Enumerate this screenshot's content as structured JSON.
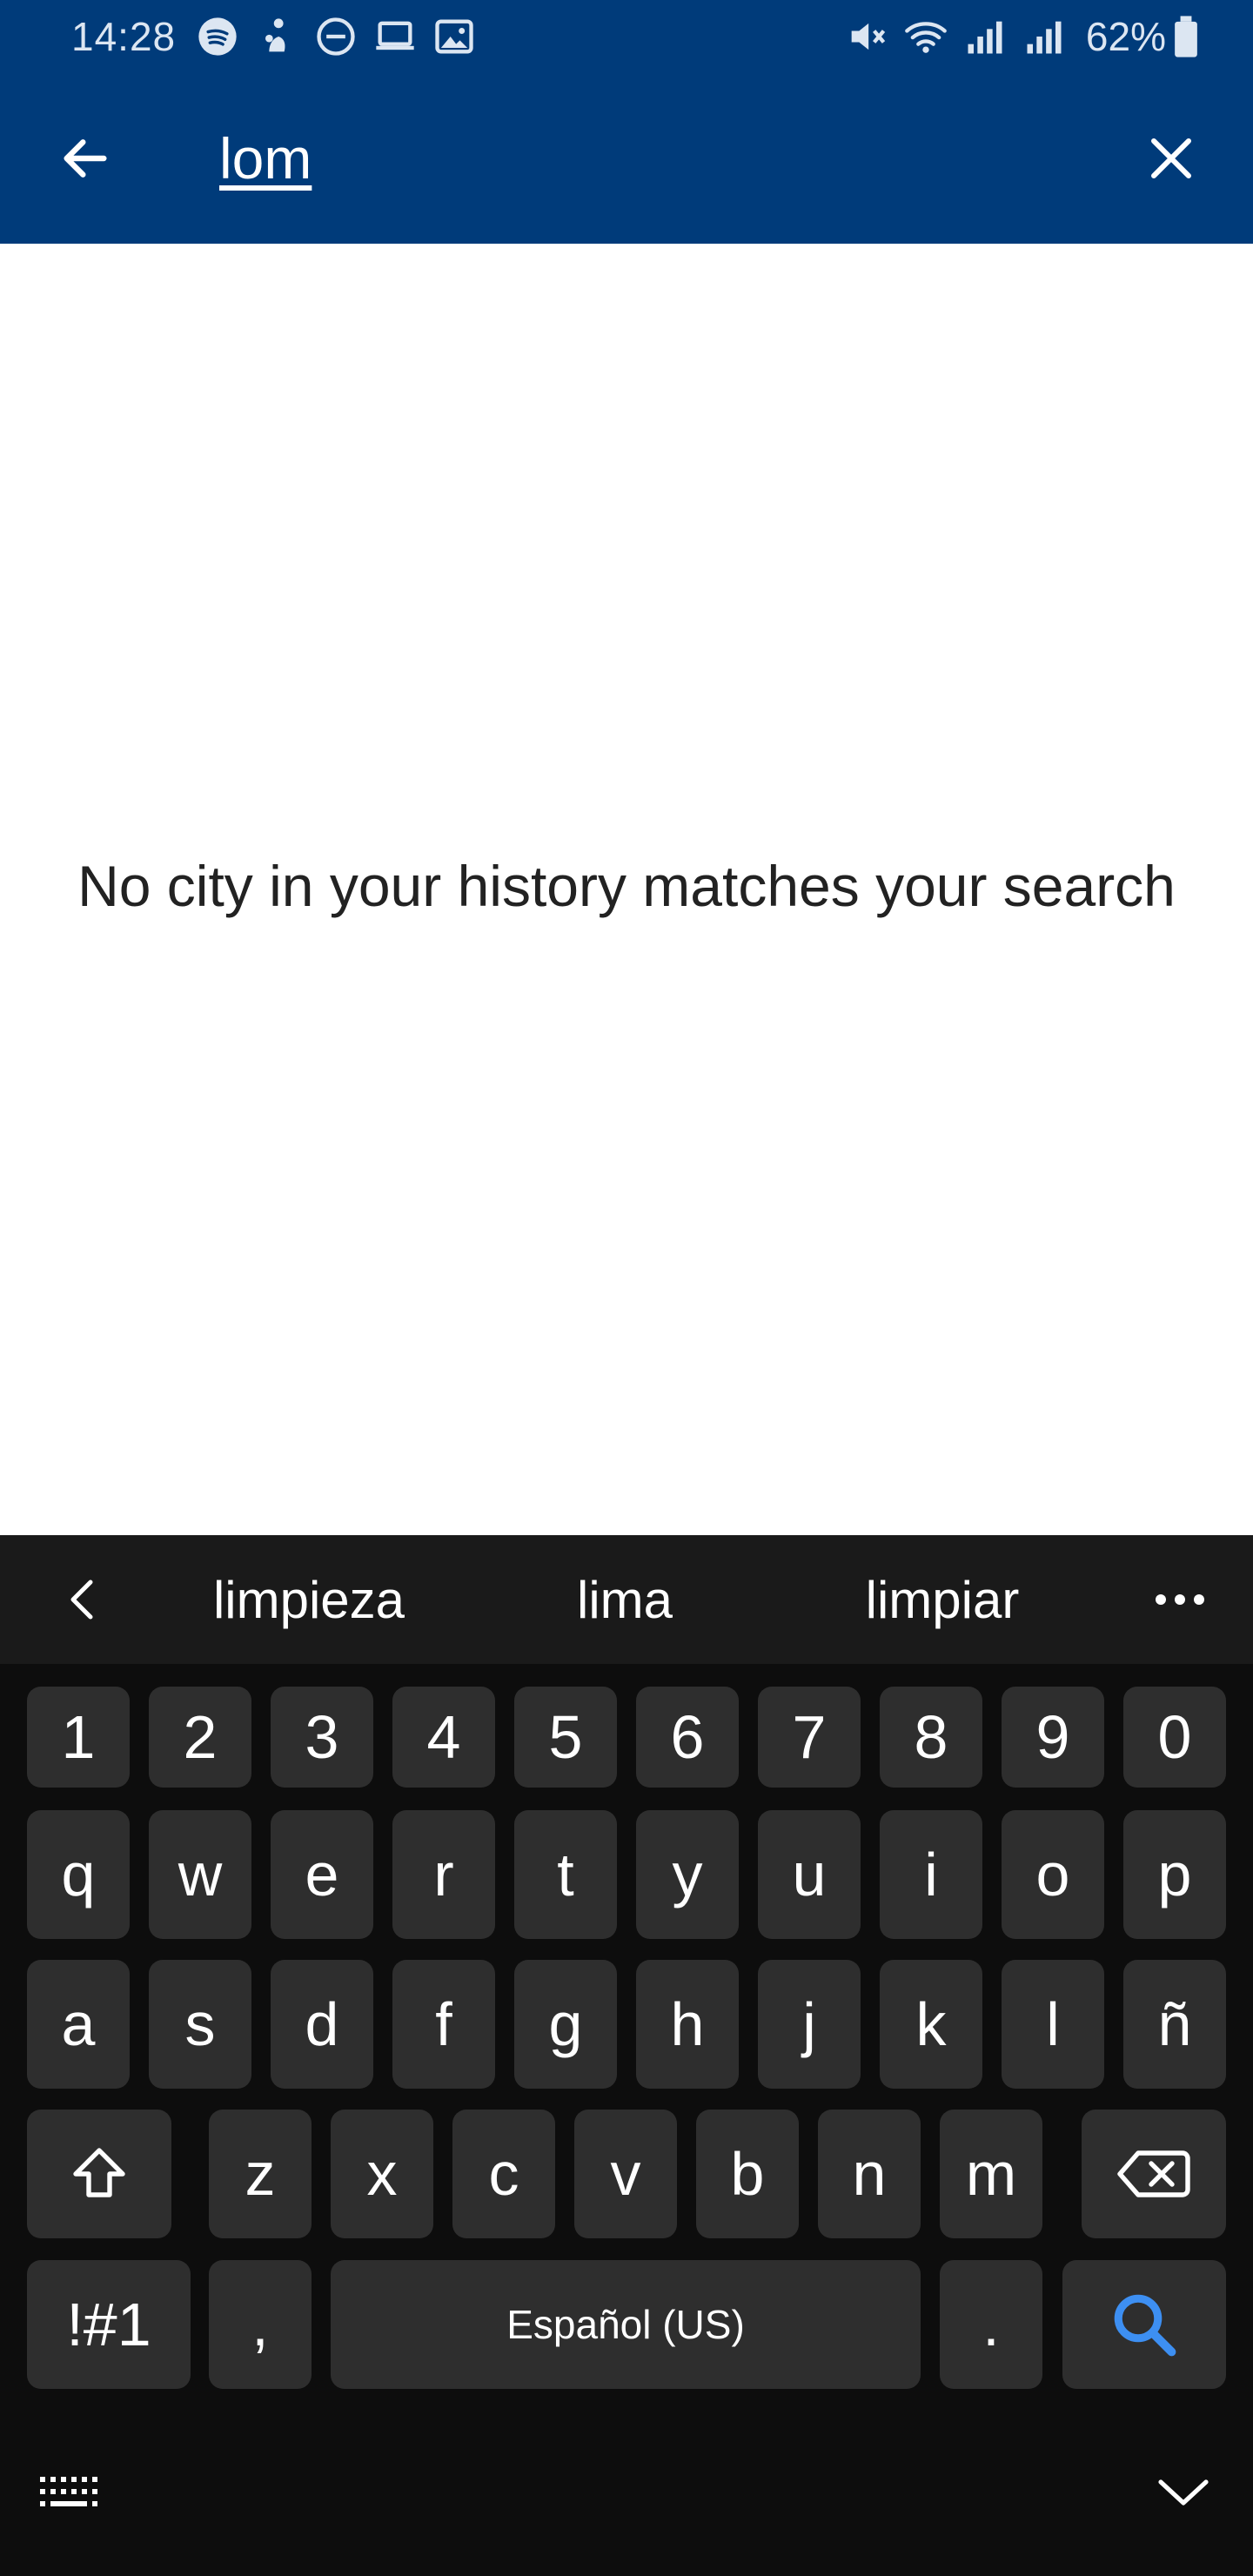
{
  "status_bar": {
    "time": "14:28",
    "battery": "62%",
    "left_icons": [
      "spotify-icon",
      "notification-icon",
      "do-not-disturb-icon",
      "laptop-icon",
      "image-icon"
    ],
    "right_icons": [
      "mute-icon",
      "wifi-icon",
      "signal-icon",
      "signal-icon",
      "battery-icon"
    ]
  },
  "app_bar": {
    "search_value": "lom",
    "back_icon": "arrow-left-icon",
    "clear_icon": "close-icon",
    "background": "#003b7a"
  },
  "content": {
    "empty_message": "No city in your history matches your search"
  },
  "keyboard": {
    "suggestions": [
      "limpieza",
      "lima",
      "limpiar"
    ],
    "row_numbers": [
      "1",
      "2",
      "3",
      "4",
      "5",
      "6",
      "7",
      "8",
      "9",
      "0"
    ],
    "row_1": [
      "q",
      "w",
      "e",
      "r",
      "t",
      "y",
      "u",
      "i",
      "o",
      "p"
    ],
    "row_2": [
      "a",
      "s",
      "d",
      "f",
      "g",
      "h",
      "j",
      "k",
      "l",
      "ñ"
    ],
    "row_3": [
      "z",
      "x",
      "c",
      "v",
      "b",
      "n",
      "m"
    ],
    "symbols_label": "!#1",
    "comma_label": ",",
    "space_label": "Español (US)",
    "period_label": ".",
    "search_key_color": "#3d8ff2"
  }
}
